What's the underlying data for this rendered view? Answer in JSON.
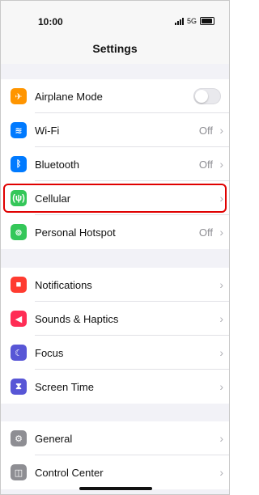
{
  "status": {
    "time": "10:00",
    "network": "5G"
  },
  "header": {
    "title": "Settings"
  },
  "group1": [
    {
      "label": "Airplane Mode",
      "value": "",
      "icon": "airplane-icon",
      "color": "#FF9500",
      "toggle": true
    },
    {
      "label": "Wi-Fi",
      "value": "Off",
      "icon": "wifi-icon",
      "color": "#007AFF"
    },
    {
      "label": "Bluetooth",
      "value": "Off",
      "icon": "bluetooth-icon",
      "color": "#007AFF"
    },
    {
      "label": "Cellular",
      "value": "",
      "icon": "cellular-icon",
      "color": "#34C759",
      "highlighted": true
    },
    {
      "label": "Personal Hotspot",
      "value": "Off",
      "icon": "hotspot-icon",
      "color": "#34C759"
    }
  ],
  "group2": [
    {
      "label": "Notifications",
      "icon": "notifications-icon",
      "color": "#FF3B30"
    },
    {
      "label": "Sounds & Haptics",
      "icon": "sound-icon",
      "color": "#FF2D55"
    },
    {
      "label": "Focus",
      "icon": "focus-moon-icon",
      "color": "#5856D6"
    },
    {
      "label": "Screen Time",
      "icon": "hourglass-icon",
      "color": "#5856D6"
    }
  ],
  "group3": [
    {
      "label": "General",
      "icon": "gear-icon",
      "color": "#8E8E93"
    },
    {
      "label": "Control Center",
      "icon": "control-center-icon",
      "color": "#8E8E93"
    }
  ]
}
